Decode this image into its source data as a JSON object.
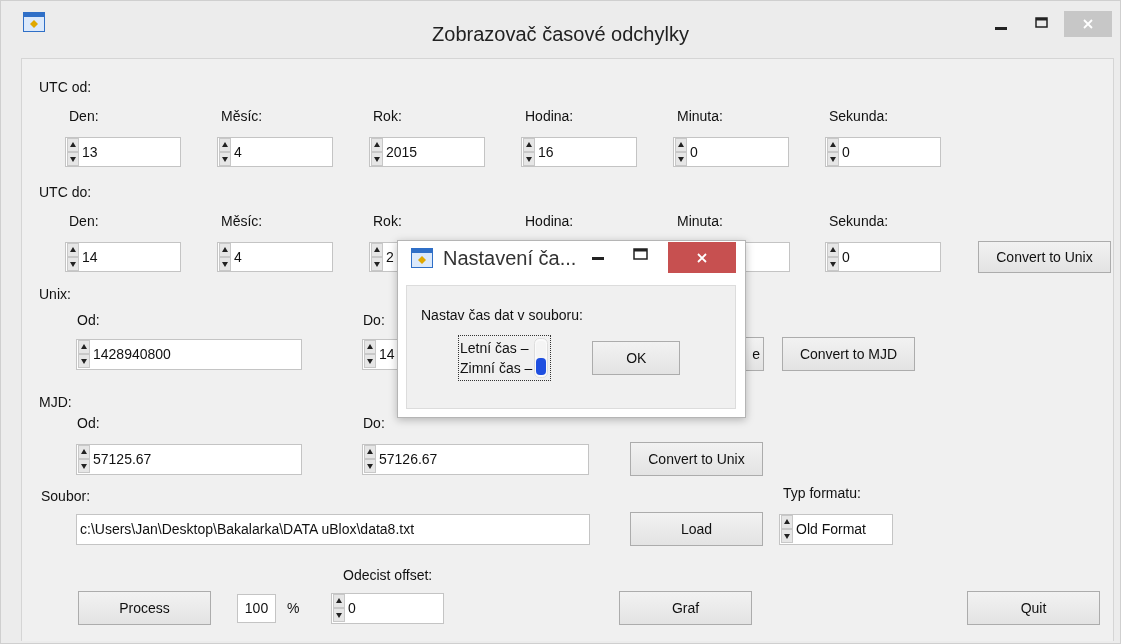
{
  "window": {
    "title": "Zobrazovač časové odchylky"
  },
  "utc_from": {
    "label": "UTC od:",
    "fields": [
      {
        "label": "Den:",
        "value": "13",
        "kind": "spinner"
      },
      {
        "label": "Měsíc:",
        "value": "4",
        "kind": "spinner"
      },
      {
        "label": "Rok:",
        "value": "2015",
        "kind": "spinner"
      },
      {
        "label": "Hodina:",
        "value": "16",
        "kind": "spinner"
      },
      {
        "label": "Minuta:",
        "value": "0",
        "kind": "spinner"
      },
      {
        "label": "Sekunda:",
        "value": "0",
        "kind": "spinner"
      }
    ]
  },
  "utc_to": {
    "label": "UTC do:",
    "fields": [
      {
        "label": "Den:",
        "value": "14",
        "kind": "spinner"
      },
      {
        "label": "Měsíc:",
        "value": "4",
        "kind": "spinner"
      },
      {
        "label": "Rok:",
        "value": "2",
        "kind": "clipped_right"
      },
      {
        "label": "Hodina:",
        "kind": "covered"
      },
      {
        "label": "Minuta:",
        "kind": "clipped_left"
      },
      {
        "label": "Sekunda:",
        "value": "0",
        "kind": "spinner"
      }
    ],
    "button": "Convert to Unix"
  },
  "unix": {
    "label": "Unix:",
    "from_label": "Od:",
    "from_value": "1428940800",
    "to_label": "Do:",
    "to_value": "14",
    "buttons": [
      "e",
      "Convert to MJD"
    ]
  },
  "mjd": {
    "label": "MJD:",
    "from_label": "Od:",
    "from_value": "57125.67",
    "to_label": "Do:",
    "to_value": "57126.67",
    "button": "Convert to Unix"
  },
  "file": {
    "label": "Soubor:",
    "value": "c:\\Users\\Jan\\Desktop\\Bakalarka\\DATA uBlox\\data8.txt",
    "button": "Load"
  },
  "format": {
    "label": "Typ formatu:",
    "value": "Old Format"
  },
  "offset": {
    "label": "Odecist offset:",
    "value": "0"
  },
  "process": {
    "button": "Process",
    "percent": "100",
    "unit": "%"
  },
  "buttons": {
    "graph": "Graf",
    "quit": "Quit"
  },
  "dialog": {
    "title": "Nastavení ča...",
    "prompt": "Nastav čas dat v souboru:",
    "options": [
      {
        "label": "Letní čas –",
        "selected": false
      },
      {
        "label": "Zimní čas –",
        "selected": true
      }
    ],
    "button": "OK"
  }
}
